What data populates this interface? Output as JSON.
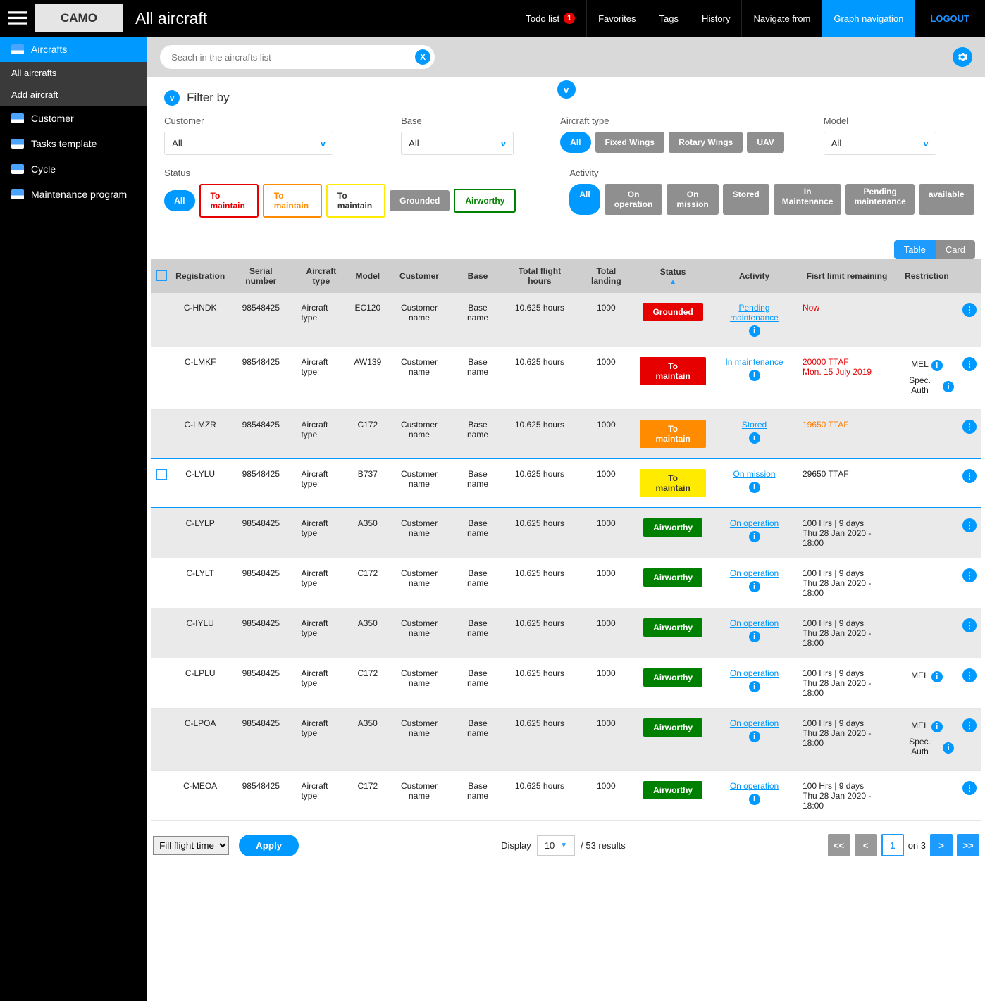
{
  "header": {
    "brand": "CAMO",
    "title": "All aircraft",
    "nav": [
      {
        "label": "Todo list",
        "badge": "1"
      },
      {
        "label": "Favorites"
      },
      {
        "label": "Tags"
      },
      {
        "label": "History"
      },
      {
        "label": "Navigate from"
      },
      {
        "label": "Graph navigation",
        "active": true
      }
    ],
    "logout": "LOGOUT"
  },
  "sidebar": {
    "items": [
      {
        "label": "Aircrafts",
        "active": true,
        "sub": [
          {
            "label": "All aircrafts"
          },
          {
            "label": "Add aircraft"
          }
        ]
      },
      {
        "label": "Customer"
      },
      {
        "label": "Tasks template"
      },
      {
        "label": "Cycle"
      },
      {
        "label": "Maintenance program"
      }
    ]
  },
  "search": {
    "placeholder": "Seach in the aircrafts list"
  },
  "filter": {
    "title": "Filter by",
    "customer": {
      "label": "Customer",
      "value": "All"
    },
    "base": {
      "label": "Base",
      "value": "All"
    },
    "aircraft_type": {
      "label": "Aircraft type",
      "options": [
        "All",
        "Fixed Wings",
        "Rotary Wings",
        "UAV"
      ]
    },
    "model": {
      "label": "Model",
      "value": "All"
    },
    "status": {
      "label": "Status",
      "options": [
        "All",
        "To maintain",
        "To maintain",
        "To maintain",
        "Grounded",
        "Airworthy"
      ]
    },
    "activity": {
      "label": "Activity",
      "options": [
        "All",
        "On operation",
        "On mission",
        "Stored",
        "In Maintenance",
        "Pending maintenance",
        "available"
      ]
    }
  },
  "view": {
    "table": "Table",
    "card": "Card"
  },
  "columns": [
    "Registration",
    "Serial number",
    "Aircraft type",
    "Model",
    "Customer",
    "Base",
    "Total flight hours",
    "Total landing",
    "Status",
    "Activity",
    "Fisrt limit remaining",
    "Restriction"
  ],
  "rows": [
    {
      "reg": "C-HNDK",
      "sn": "98548425",
      "type": "Aircraft type",
      "model": "EC120",
      "cust": "Customer name",
      "base": "Base name",
      "tfh": "10.625 hours",
      "tl": "1000",
      "status": "Grounded",
      "status_style": "red",
      "activity": "Pending maintenance",
      "limit": "Now",
      "limit_style": "limit-red",
      "restrict": [],
      "alt": true
    },
    {
      "reg": "C-LMKF",
      "sn": "98548425",
      "type": "Aircraft type",
      "model": "AW139",
      "cust": "Customer name",
      "base": "Base name",
      "tfh": "10.625 hours",
      "tl": "1000",
      "status": "To maintain",
      "status_style": "red",
      "activity": "In maintenance",
      "limit": "20000 TTAF",
      "limit2": "Mon. 15 July 2019",
      "limit_style": "limit-red",
      "restrict": [
        "MEL",
        "Spec. Auth"
      ]
    },
    {
      "reg": "C-LMZR",
      "sn": "98548425",
      "type": "Aircraft type",
      "model": "C172",
      "cust": "Customer name",
      "base": "Base name",
      "tfh": "10.625 hours",
      "tl": "1000",
      "status": "To maintain",
      "status_style": "orange",
      "activity": "Stored",
      "limit": "19650 TTAF",
      "limit_style": "limit-orange",
      "restrict": [],
      "alt": true
    },
    {
      "reg": "C-LYLU",
      "sn": "98548425",
      "type": "Aircraft type",
      "model": "B737",
      "cust": "Customer name",
      "base": "Base name",
      "tfh": "10.625 hours",
      "tl": "1000",
      "status": "To maintain",
      "status_style": "yellow",
      "activity": "On mission",
      "limit": "29650 TTAF",
      "restrict": [],
      "selected": true,
      "checkbox": true
    },
    {
      "reg": "C-LYLP",
      "sn": "98548425",
      "type": "Aircraft type",
      "model": "A350",
      "cust": "Customer name",
      "base": "Base name",
      "tfh": "10.625 hours",
      "tl": "1000",
      "status": "Airworthy",
      "status_style": "green",
      "activity": "On operation",
      "limit": "100 Hrs | 9 days",
      "limit2": "Thu 28 Jan 2020 - 18:00",
      "restrict": [],
      "alt": true
    },
    {
      "reg": "C-LYLT",
      "sn": "98548425",
      "type": "Aircraft type",
      "model": "C172",
      "cust": "Customer name",
      "base": "Base name",
      "tfh": "10.625 hours",
      "tl": "1000",
      "status": "Airworthy",
      "status_style": "green",
      "activity": "On operation",
      "limit": "100 Hrs | 9 days",
      "limit2": "Thu 28 Jan 2020 - 18:00",
      "restrict": []
    },
    {
      "reg": "C-IYLU",
      "sn": "98548425",
      "type": "Aircraft type",
      "model": "A350",
      "cust": "Customer name",
      "base": "Base name",
      "tfh": "10.625 hours",
      "tl": "1000",
      "status": "Airworthy",
      "status_style": "green",
      "activity": "On operation",
      "limit": "100 Hrs | 9 days",
      "limit2": "Thu 28 Jan 2020 - 18:00",
      "restrict": [],
      "alt": true
    },
    {
      "reg": "C-LPLU",
      "sn": "98548425",
      "type": "Aircraft type",
      "model": "C172",
      "cust": "Customer name",
      "base": "Base name",
      "tfh": "10.625 hours",
      "tl": "1000",
      "status": "Airworthy",
      "status_style": "green",
      "activity": "On operation",
      "limit": "100 Hrs | 9 days",
      "limit2": "Thu 28 Jan 2020 - 18:00",
      "restrict": [
        "MEL"
      ]
    },
    {
      "reg": "C-LPOA",
      "sn": "98548425",
      "type": "Aircraft type",
      "model": "A350",
      "cust": "Customer name",
      "base": "Base name",
      "tfh": "10.625 hours",
      "tl": "1000",
      "status": "Airworthy",
      "status_style": "green",
      "activity": "On operation",
      "limit": "100 Hrs | 9 days",
      "limit2": "Thu 28 Jan 2020 - 18:00",
      "restrict": [
        "MEL",
        "Spec. Auth"
      ],
      "alt": true
    },
    {
      "reg": "C-MEOA",
      "sn": "98548425",
      "type": "Aircraft type",
      "model": "C172",
      "cust": "Customer name",
      "base": "Base name",
      "tfh": "10.625 hours",
      "tl": "1000",
      "status": "Airworthy",
      "status_style": "green",
      "activity": "On operation",
      "limit": "100 Hrs | 9 days",
      "limit2": "Thu 28 Jan 2020 - 18:00",
      "restrict": []
    }
  ],
  "footer": {
    "bulk": "Fill flight time",
    "apply": "Apply",
    "display": "Display",
    "per_page": "10",
    "results": "/ 53 results",
    "page": "1",
    "of": "on 3"
  }
}
